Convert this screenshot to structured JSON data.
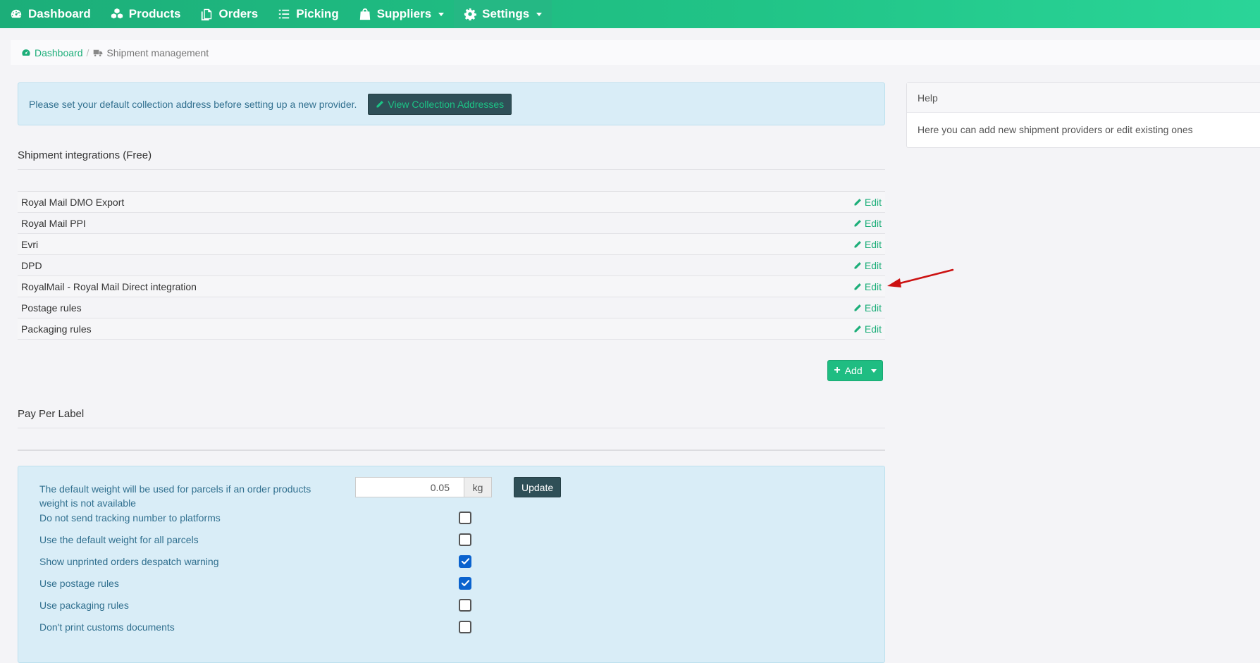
{
  "nav": {
    "items": [
      {
        "label": "Dashboard",
        "icon": "dashboard-icon"
      },
      {
        "label": "Products",
        "icon": "cubes-icon"
      },
      {
        "label": "Orders",
        "icon": "orders-icon"
      },
      {
        "label": "Picking",
        "icon": "list-icon"
      },
      {
        "label": "Suppliers",
        "icon": "shopping-bag-icon",
        "dropdown": true
      },
      {
        "label": "Settings",
        "icon": "gear-icon",
        "dropdown": true,
        "active": true
      }
    ]
  },
  "breadcrumb": {
    "home": "Dashboard",
    "separator": "/",
    "current": "Shipment management"
  },
  "alert": {
    "text": "Please set your default collection address before setting up a new provider.",
    "button": "View Collection Addresses"
  },
  "integrations": {
    "title": "Shipment integrations (Free)",
    "edit_label": "Edit",
    "rows": [
      {
        "name": "Royal Mail DMO Export"
      },
      {
        "name": "Royal Mail PPI"
      },
      {
        "name": "Evri"
      },
      {
        "name": "DPD"
      },
      {
        "name": "RoyalMail - Royal Mail Direct integration"
      },
      {
        "name": "Postage rules"
      },
      {
        "name": "Packaging rules"
      }
    ],
    "add_label": "Add"
  },
  "help": {
    "title": "Help",
    "body": "Here you can add new shipment providers or edit existing ones"
  },
  "pay_per_label": {
    "title": "Pay Per Label"
  },
  "settings": {
    "weight_label": "The default weight will be used for parcels if an order products weight is not available",
    "weight_value": "0.05",
    "weight_unit": "kg",
    "update_label": "Update",
    "options": [
      {
        "label": "Do not send tracking number to platforms",
        "checked": false
      },
      {
        "label": "Use the default weight for all parcels",
        "checked": false
      },
      {
        "label": "Show unprinted orders despatch warning",
        "checked": true
      },
      {
        "label": "Use postage rules",
        "checked": true
      },
      {
        "label": "Use packaging rules",
        "checked": false
      },
      {
        "label": "Don't print customs documents",
        "checked": false
      }
    ]
  },
  "colors": {
    "brand_green": "#1cae79",
    "dark_button": "#2f4f57",
    "info_bg": "#d9edf7",
    "annotation_red": "#cc1111"
  }
}
